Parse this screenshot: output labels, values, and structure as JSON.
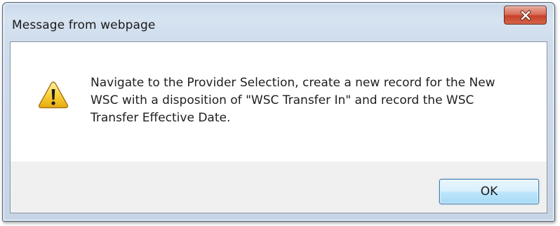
{
  "dialog": {
    "title": "Message from webpage",
    "close_icon": "close-icon",
    "message_icon": "warning-icon",
    "message_lines": [
      "Navigate to the Provider Selection, create a new record for the New",
      "WSC with a disposition of \"WSC Transfer In\" and record the WSC",
      "Transfer Effective Date."
    ],
    "ok_label": "OK"
  },
  "colors": {
    "frame": "#c9d8ea",
    "close_button": "#c8402a",
    "warning_fill": "#f5c518",
    "ok_button_border": "#3c7fb1"
  }
}
